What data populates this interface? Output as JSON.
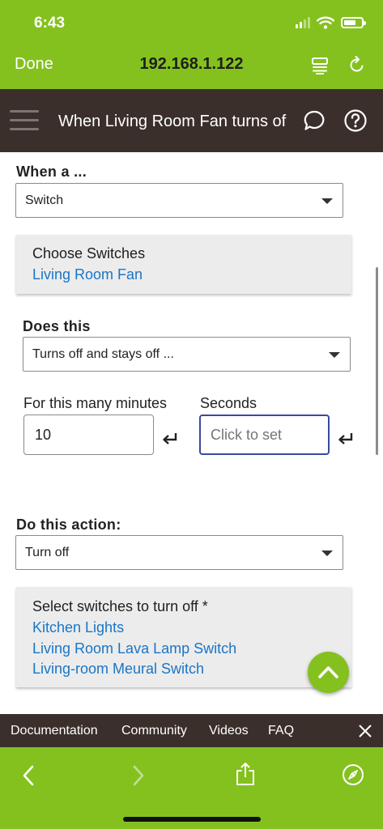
{
  "status_bar": {
    "time": "6:43"
  },
  "browser": {
    "done_label": "Done",
    "url": "192.168.1.122",
    "icons": {
      "reader": "reader-view-icon",
      "reload": "reload-icon",
      "back": "back-arrow-icon",
      "forward": "forward-arrow-icon",
      "share": "share-icon",
      "safari": "compass-icon"
    }
  },
  "app_header": {
    "title": "When Living Room Fan turns of",
    "icons": {
      "menu": "hamburger-menu-icon",
      "chat": "chat-bubble-icon",
      "help": "help-icon"
    }
  },
  "trigger": {
    "label": "When a ...",
    "device_type": "Switch",
    "card_title": "Choose Switches",
    "selected_device": "Living Room Fan"
  },
  "condition": {
    "label": "Does this",
    "value": "Turns off and stays off ...",
    "minutes_label": "For this many minutes",
    "minutes_value": "10",
    "seconds_label": "Seconds",
    "seconds_placeholder": "Click to set"
  },
  "action": {
    "label": "Do this action:",
    "value": "Turn off",
    "card_title": "Select switches to turn off *",
    "devices": [
      "Kitchen Lights",
      "Living Room Lava Lamp Switch",
      "Living-room Meural Switch"
    ]
  },
  "footer_nav": {
    "links": [
      "Documentation",
      "Community",
      "Videos",
      "FAQ"
    ]
  },
  "colors": {
    "brand_green": "#84c11f",
    "header_brown": "#3b2f2c",
    "link_blue": "#1a76c7",
    "focus_blue": "#3949a0"
  }
}
